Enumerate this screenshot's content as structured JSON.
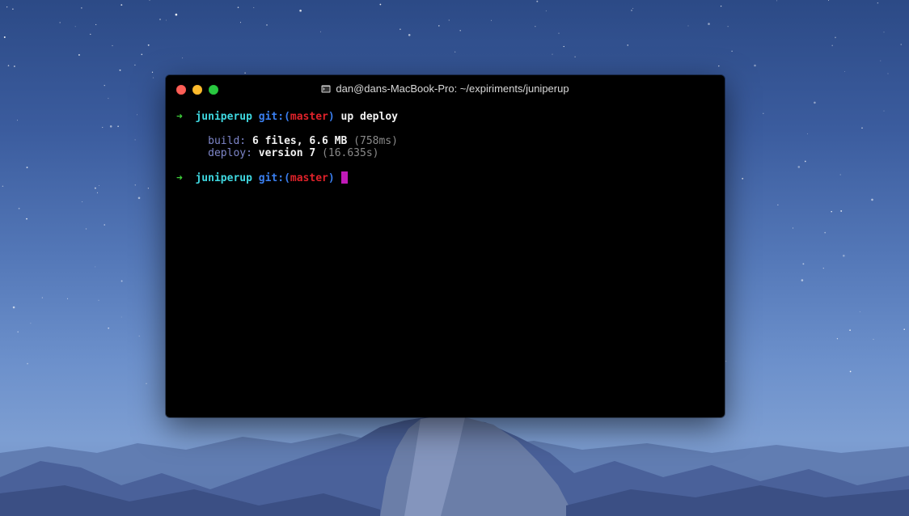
{
  "window": {
    "title": "dan@dans-MacBook-Pro: ~/expiriments/juniperup"
  },
  "terminal": {
    "prompt_symbol": "➜",
    "line1": {
      "dir": "juniperup",
      "git_prefix": "git:(",
      "branch": "master",
      "git_suffix": ")",
      "command": "up deploy"
    },
    "output": [
      {
        "label": "build:",
        "value": "6 files, 6.6 MB",
        "detail": "(758ms)"
      },
      {
        "label": "deploy:",
        "value": "version 7",
        "detail": "(16.635s)"
      }
    ],
    "line2": {
      "dir": "juniperup",
      "git_prefix": "git:(",
      "branch": "master",
      "git_suffix": ")"
    }
  },
  "colors": {
    "close": "#fc5f57",
    "minimize": "#fdbb2d",
    "zoom": "#29c840",
    "prompt_arrow": "#3fd13a",
    "dir": "#3fd8e0",
    "git": "#3a7ff0",
    "branch": "#e0222a",
    "cursor": "#c01ab8"
  }
}
